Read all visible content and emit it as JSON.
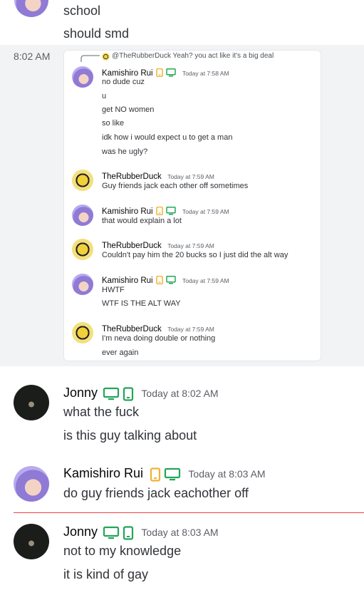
{
  "top": {
    "lines": [
      "school",
      "should smd"
    ]
  },
  "screenshot_message": {
    "timestamp": "8:02 AM",
    "reply_preview": "@TheRubberDuck Yeah? you act like it's a big deal",
    "groups": [
      {
        "author": "Kamishiro Rui",
        "time": "Today at 7:58 AM",
        "lines": [
          "no dude cuz",
          "u",
          "get NO women",
          "so like",
          "idk how i would expect u to get a man",
          "was he ugly?"
        ]
      },
      {
        "author": "TheRubberDuck",
        "time": "Today at 7:59 AM",
        "lines": [
          "Guy friends jack each other off sometimes"
        ]
      },
      {
        "author": "Kamishiro Rui",
        "time": "Today at 7:59 AM",
        "lines": [
          "that would explain a lot"
        ]
      },
      {
        "author": "TheRubberDuck",
        "time": "Today at 7:59 AM",
        "lines": [
          "Couldn't pay him the 20 bucks so I just did the alt way"
        ]
      },
      {
        "author": "Kamishiro Rui",
        "time": "Today at 7:59 AM",
        "lines": [
          "HWTF",
          "WTF IS THE ALT WAY"
        ]
      },
      {
        "author": "TheRubberDuck",
        "time": "Today at 7:59 AM",
        "lines": [
          "I'm neva doing double or nothing",
          "ever again"
        ]
      }
    ]
  },
  "messages": [
    {
      "author": "Jonny",
      "time": "Today at 8:02 AM",
      "lines": [
        "what the fuck",
        "is this guy talking about"
      ]
    },
    {
      "author": "Kamishiro Rui",
      "time": "Today at 8:03 AM",
      "lines": [
        "do guy friends jack eachother off"
      ]
    },
    {
      "author": "Jonny",
      "time": "Today at 8:03 AM",
      "lines": [
        "not to my knowledge",
        "it is kind of gay"
      ]
    }
  ],
  "colors": {
    "phone_orange": "#f0b232",
    "desktop_green": "#23a559",
    "new_divider_red": "#f23f43",
    "message_hover_bg": "#f2f3f5"
  },
  "icons": {
    "desktop": "desktop-icon",
    "mobile": "mobile-phone-icon",
    "reply": "reply-arrow-icon"
  }
}
